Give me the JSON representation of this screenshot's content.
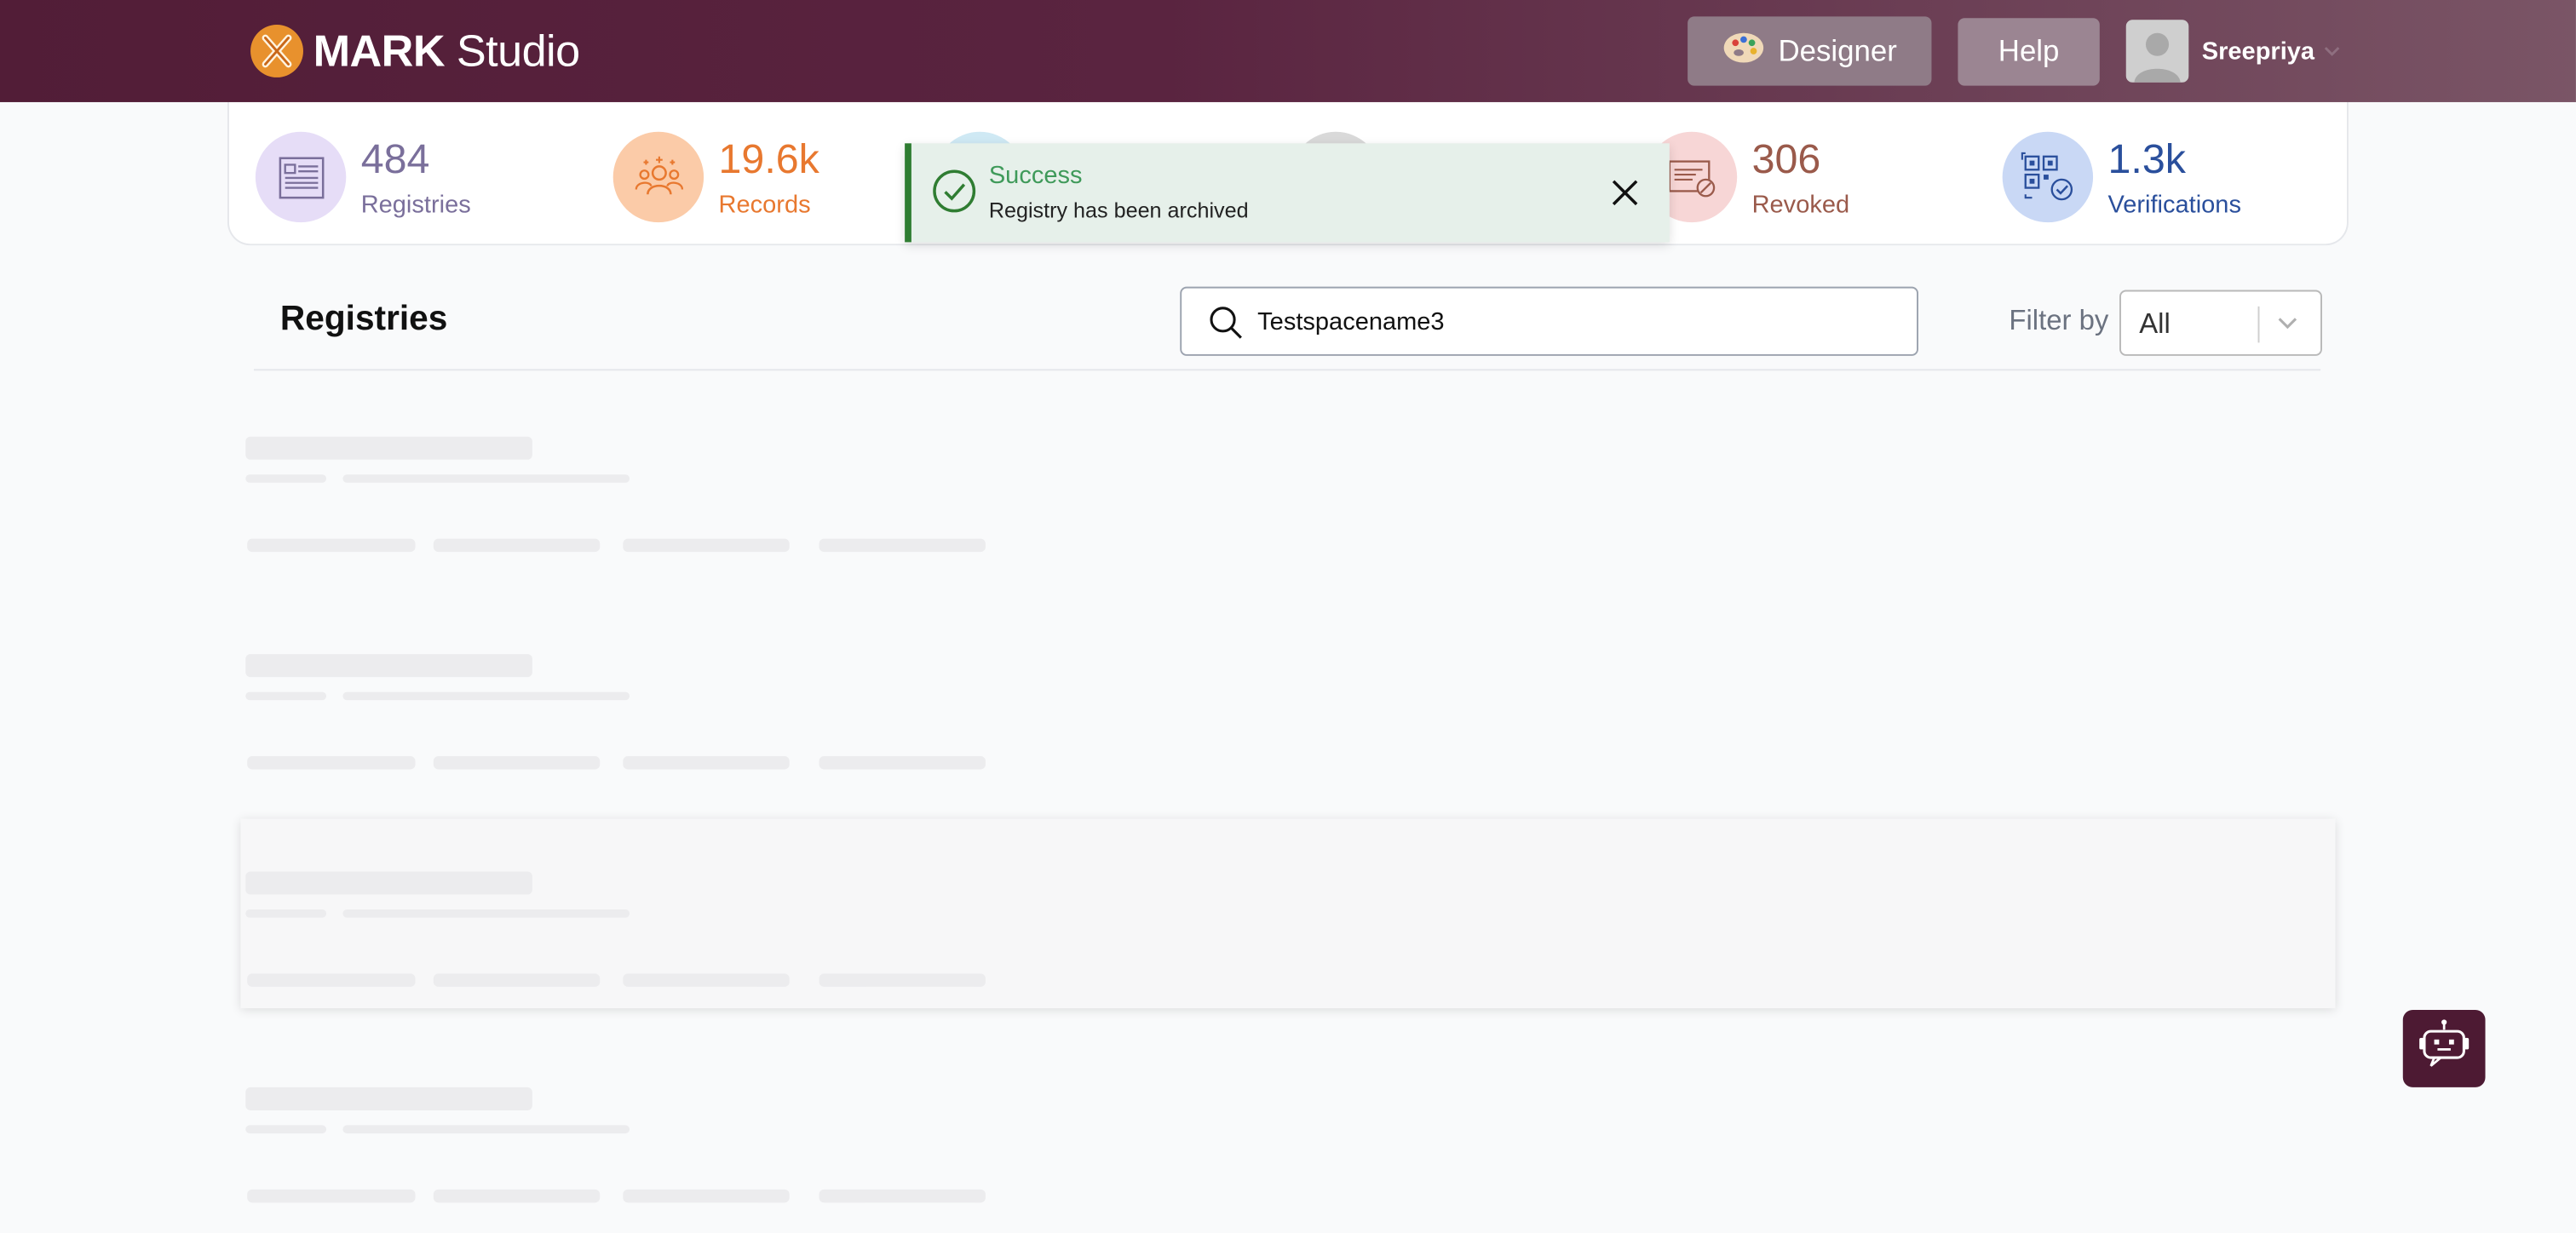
{
  "app": {
    "brand_bold": "MARK",
    "brand_light": "Studio"
  },
  "header": {
    "designer_label": "Designer",
    "help_label": "Help",
    "user_name": "Sreepriya"
  },
  "stats": [
    {
      "value": "484",
      "label": "Registries",
      "color": "#7a6f9b",
      "bg": "#e6ddf7",
      "icon": "registry-icon"
    },
    {
      "value": "19.6k",
      "label": "Records",
      "color": "#e8782f",
      "bg": "#fbcba8",
      "icon": "people-icon"
    },
    {
      "value": "306",
      "label": "Revoked",
      "color": "#9a5a4b",
      "bg": "#f7d6d6",
      "icon": "revoked-certificate-icon"
    },
    {
      "value": "1.3k",
      "label": "Verifications",
      "color": "#2a4f9c",
      "bg": "#c9d8f5",
      "icon": "qr-verify-icon"
    }
  ],
  "toast": {
    "title": "Success",
    "message": "Registry has been archived",
    "accent": "#2f7d32"
  },
  "registries": {
    "title": "Registries",
    "search_value": "Testspacename3",
    "filter_label": "Filter by",
    "filter_value": "All"
  }
}
